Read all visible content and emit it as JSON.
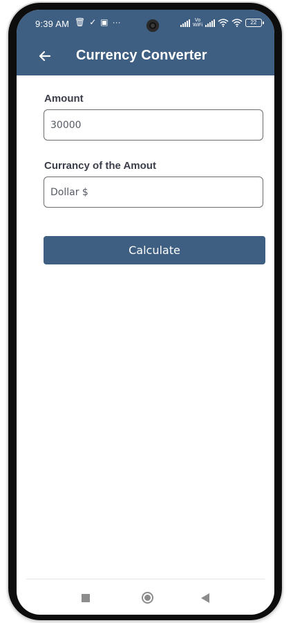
{
  "status_bar": {
    "time": "9:39 AM",
    "left_icons": [
      "trash-icon",
      "download-check-icon",
      "photo-icon",
      "more-dots-icon"
    ],
    "vowifi_top": "Vo",
    "vowifi_bottom": "WiFi",
    "battery": "22"
  },
  "app_bar": {
    "title": "Currency Converter",
    "back_icon": "arrow-left-icon"
  },
  "form": {
    "amount": {
      "label": "Amount",
      "value": "30000"
    },
    "currency": {
      "label": "Currancy of the Amout",
      "value": "Dollar $"
    },
    "calculate_label": "Calculate"
  },
  "nav_bar": {
    "icons": [
      "recent-apps-icon",
      "home-icon",
      "back-icon"
    ]
  },
  "colors": {
    "primary": "#3f5f82",
    "label_text": "#3b3e4a",
    "input_text": "#555a64",
    "input_border": "#6b6b6b"
  }
}
